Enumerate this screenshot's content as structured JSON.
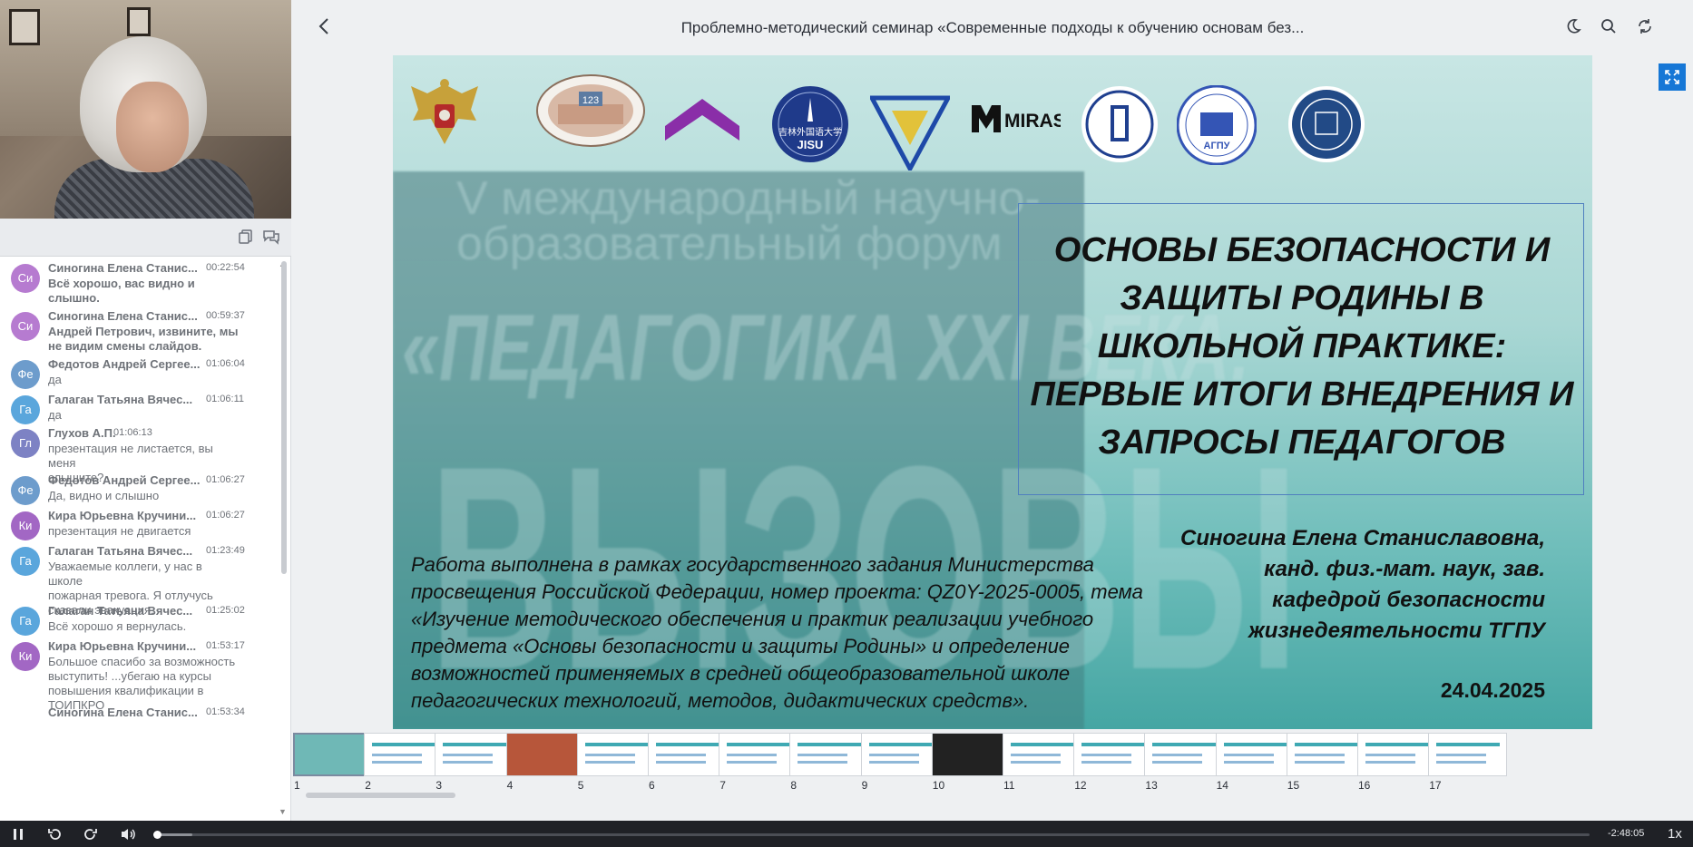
{
  "header": {
    "title": "Проблемно-методический семинар «Современные подходы к обучению основам без...",
    "back_icon": "chevron-left-icon",
    "icons": [
      "moon-icon",
      "search-icon",
      "sync-icon"
    ]
  },
  "panel": {
    "tool_icons": [
      "copy-icon",
      "chat-bubbles-icon"
    ]
  },
  "chat": [
    {
      "initials": "Си",
      "name": "Синогина Елена Станис...",
      "time": "00:22:54",
      "lines": [
        "Всё хорошо, вас видно и",
        "слышно."
      ],
      "bold": true,
      "color": "#b67bd0"
    },
    {
      "initials": "Си",
      "name": "Синогина Елена Станис...",
      "time": "00:59:37",
      "lines": [
        "Андрей Петрович, извините, мы",
        "не видим смены слайдов."
      ],
      "bold": true,
      "color": "#b67bd0"
    },
    {
      "initials": "Фе",
      "name": "Федотов Андрей Сергее...",
      "time": "01:06:04",
      "lines": [
        "да"
      ],
      "bold": false,
      "color": "#6d9ccc"
    },
    {
      "initials": "Га",
      "name": "Галаган Татьяна Вячес...",
      "time": "01:06:11",
      "lines": [
        "да"
      ],
      "bold": false,
      "color": "#5aa6dc"
    },
    {
      "initials": "Гл",
      "name": "Глухов А.П.",
      "time": "01:06:13",
      "lines": [
        "презентация не листается, вы меня",
        "слышите?"
      ],
      "bold": false,
      "color": "#7d82c4"
    },
    {
      "initials": "Фе",
      "name": "Федотов Андрей Сергее...",
      "time": "01:06:27",
      "lines": [
        "Да, видно и слышно"
      ],
      "bold": false,
      "color": "#6d9ccc"
    },
    {
      "initials": "Ки",
      "name": "Кира Юрьевна Кручини...",
      "time": "01:06:27",
      "lines": [
        "презентация не двигается"
      ],
      "bold": false,
      "color": "#a267c4"
    },
    {
      "initials": "Га",
      "name": "Галаган Татьяна Вячес...",
      "time": "01:23:49",
      "lines": [
        "Уважаемые коллеги, у нас в школе",
        "пожарная тревога. Я отлучусь",
        "сказали эвакуация."
      ],
      "bold": false,
      "color": "#5aa6dc"
    },
    {
      "initials": "Га",
      "name": "Галаган Татьяна Вячес...",
      "time": "01:25:02",
      "lines": [
        "Всё хорошо я вернулась."
      ],
      "bold": false,
      "color": "#5aa6dc"
    },
    {
      "initials": "Ки",
      "name": "Кира Юрьевна Кручини...",
      "time": "01:53:17",
      "lines": [
        "Большое спасибо за возможность",
        "выступить! ...убегаю на курсы",
        "повышения квалификации в",
        "ТОИПКРО"
      ],
      "bold": false,
      "color": "#a267c4"
    },
    {
      "initials": "",
      "name": "Синогина Елена Станис...",
      "time": "01:53:34",
      "lines": [],
      "bold": true,
      "color": "#b67bd0"
    }
  ],
  "slide": {
    "logos": [
      "ministry-emblem-logo",
      "university-building-logo",
      "purple-chevron-logo",
      "jisu-logo",
      "triangle-logo",
      "miras-logo",
      "hse-logo",
      "agpu-logo",
      "round-emblem-logo"
    ],
    "logo_texts": {
      "building_number": "123",
      "jisu_cn": "吉林外国语大学",
      "jisu": "JISU",
      "miras": "MIRAS",
      "agpu": "АГПУ"
    },
    "poster": {
      "line1": "V международный научно-",
      "line2": "образовательный форум",
      "line3": "«ПЕДАГОГИКА XXI ВЕКА:",
      "line4": "ВЫЗОВЫ"
    },
    "title_lines": [
      "ОСНОВЫ БЕЗОПАСНОСТИ И",
      "ЗАЩИТЫ РОДИНЫ В",
      "ШКОЛЬНОЙ ПРАКТИКЕ:",
      "ПЕРВЫЕ ИТОГИ ВНЕДРЕНИЯ И",
      "ЗАПРОСЫ ПЕДАГОГОВ"
    ],
    "author_lines": [
      "Синогина Елена Станиславовна,",
      "канд. физ.-мат. наук, зав.",
      "кафедрой безопасности",
      "жизнедеятельности ТГПУ"
    ],
    "date": "24.04.2025",
    "work_lines": [
      "Работа выполнена в рамках государственного задания Министерства",
      "просвещения Российской Федерации, номер проекта: QZ0Y-2025-0005, тема",
      "«Изучение методического обеспечения и практик реализации учебного",
      "предмета «Основы безопасности и защиты Родины» и определение",
      "возможностей применяемых в средней общеобразовательной школе",
      "педагогических технологий, методов, дидактических средств»."
    ]
  },
  "thumbnails": {
    "numbers": [
      "1",
      "2",
      "3",
      "4",
      "5",
      "6",
      "7",
      "8",
      "9",
      "10",
      "11",
      "12",
      "13",
      "14",
      "15",
      "16",
      "17"
    ],
    "active": "1"
  },
  "player": {
    "remaining": "-2:48:05",
    "speed": "1x",
    "progress_fraction": 0.001,
    "icons": [
      "pause-icon",
      "rewind-icon",
      "forward-icon",
      "volume-icon"
    ]
  }
}
